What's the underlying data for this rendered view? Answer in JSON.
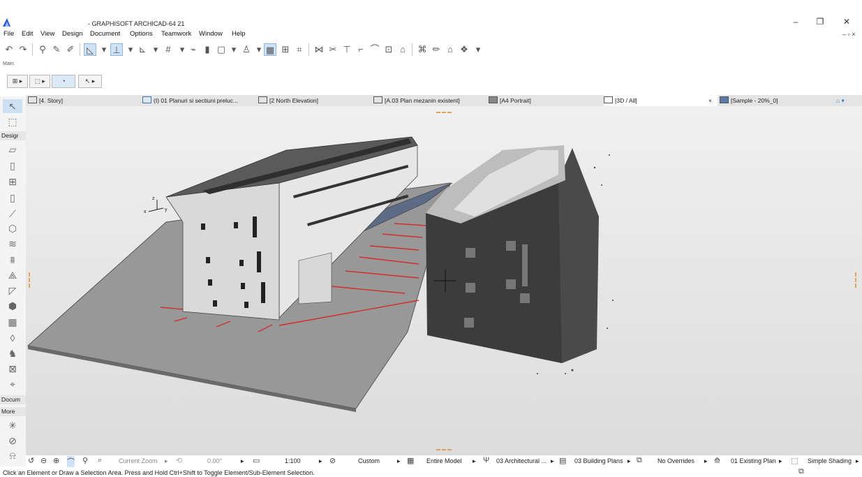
{
  "window": {
    "title": "- GRAPHISOFT ARCHICAD-64 21",
    "minimize": "–",
    "restore": "❐",
    "close": "✕",
    "mdi_controls": "– ▫ ×"
  },
  "menu": [
    "File",
    "Edit",
    "View",
    "Design",
    "Document",
    "Options",
    "Teamwork",
    "Window",
    "Help"
  ],
  "main_toolbar": {
    "label": "Main:"
  },
  "tabs": [
    {
      "label": "[4. Story]",
      "icon": "floor-plan-icon"
    },
    {
      "label": "(I) 01 Planuri si sectiuni preluc...",
      "icon": "worksheet-icon"
    },
    {
      "label": "[2 North Elevation]",
      "icon": "elevation-icon"
    },
    {
      "label": "[A.03 Plan mezanin existent]",
      "icon": "layout-icon"
    },
    {
      "label": "[A4 Portrait]",
      "icon": "layout-book-icon"
    },
    {
      "label": "[3D / All]",
      "icon": "3d-window-icon",
      "active": true,
      "close": "×"
    },
    {
      "label": "[Sample - 20%_0]",
      "icon": "point-cloud-icon"
    }
  ],
  "toolbox": {
    "groups": [
      "Desigr",
      "Docum",
      "More"
    ]
  },
  "status": {
    "zoom_label": "Current Zoom",
    "rotation": "0.00°",
    "scale": "1:100",
    "pen_set": "Custom",
    "model_filter": "Entire Model",
    "layer_combo": "03 Architectural ...",
    "view_set": "03 Building Plans",
    "overrides": "No Overrides",
    "renovation": "01 Existing Plan",
    "shading": "Simple Shading"
  },
  "hint": "Click an Element or Draw a Selection Area. Press and Hold Ctrl+Shift to Toggle Element/Sub-Element Selection.",
  "axes": {
    "x": "x",
    "y": "y",
    "z": "z"
  },
  "colors": {
    "accent": "#cfe2f6",
    "dimension_red": "#d0302a",
    "slab_grey": "#8e8e8e",
    "roof_dark": "#3b3b3b",
    "canopy_blue": "#5d6b86"
  }
}
